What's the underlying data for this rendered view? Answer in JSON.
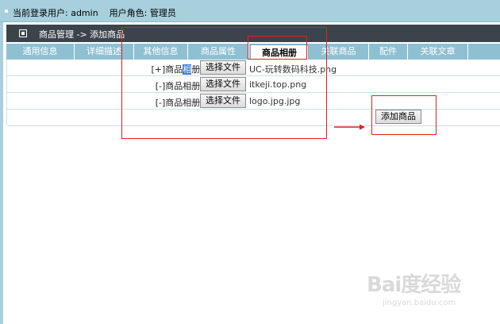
{
  "topbar": {
    "user_text": "当前登录用户: admin",
    "role_text": "用户角色: 管理员"
  },
  "titlebar": {
    "breadcrumb": "商品管理 -> 添加商品"
  },
  "tabs": [
    {
      "label": "通用信息"
    },
    {
      "label": "详细描述"
    },
    {
      "label": "其他信息"
    },
    {
      "label": "商品属性"
    },
    {
      "label": "商品相册",
      "active": true
    },
    {
      "label": "关联商品"
    },
    {
      "label": "配件"
    },
    {
      "label": "关联文章"
    }
  ],
  "gallery": {
    "rows": [
      {
        "prefix": "[+]商品",
        "highlight": "相",
        "suffix": "册:",
        "button": "选择文件",
        "filename": "UC-玩转数码科技.png"
      },
      {
        "label": "[-]商品相册:",
        "button": "选择文件",
        "filename": "itkeji.top.png"
      },
      {
        "label": "[-]商品相册:",
        "button": "选择文件",
        "filename": "logo.jpg.jpg"
      }
    ],
    "submit_label": "添加商品"
  },
  "watermark": {
    "brand": "Bai度经验",
    "url": "jingyan.baidu.com"
  },
  "colors": {
    "topbar": "#a7cfdc",
    "titlebar": "#3c444b",
    "tabbar": "#8fc0d2",
    "annotation": "#e02020"
  }
}
